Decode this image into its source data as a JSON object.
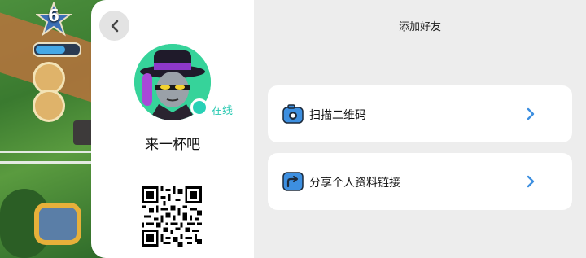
{
  "game_hud": {
    "level": "6",
    "level_progress": 0.7
  },
  "profile": {
    "status": "在线",
    "username": "来一杯吧"
  },
  "header": {
    "title": "添加好友"
  },
  "actions": [
    {
      "label": "扫描二维码",
      "icon": "camera-scan-icon"
    },
    {
      "label": "分享个人资料链接",
      "icon": "share-arrow-icon"
    }
  ],
  "colors": {
    "accent": "#3d8fe0",
    "online": "#28d1b6",
    "avatar_bg": "#36d39a",
    "panel_bg": "#ededed"
  }
}
